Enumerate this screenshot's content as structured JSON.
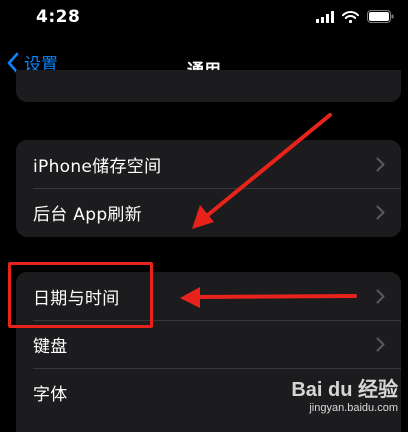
{
  "status_bar": {
    "time": "4:28"
  },
  "nav": {
    "back_label": "设置",
    "title": "通用"
  },
  "groups": [
    {
      "rows": [
        {
          "label": "iPhone储存空间"
        },
        {
          "label": "后台 App刷新"
        }
      ]
    },
    {
      "rows": [
        {
          "label": "日期与时间"
        },
        {
          "label": "键盘"
        },
        {
          "label": "字体"
        }
      ]
    }
  ],
  "watermark": {
    "logo": "Bai du 经验",
    "url": "jingyan.baidu.com"
  },
  "colors": {
    "background": "#000000",
    "group_bg": "#1c1c1e",
    "accent": "#0a84ff",
    "annotation": "#e8231c",
    "chevron": "#5a5a5f"
  },
  "icons": {
    "back": "chevron-left-icon",
    "row": "chevron-right-icon",
    "signal": "signal-icon",
    "wifi": "wifi-icon",
    "battery": "battery-icon"
  }
}
